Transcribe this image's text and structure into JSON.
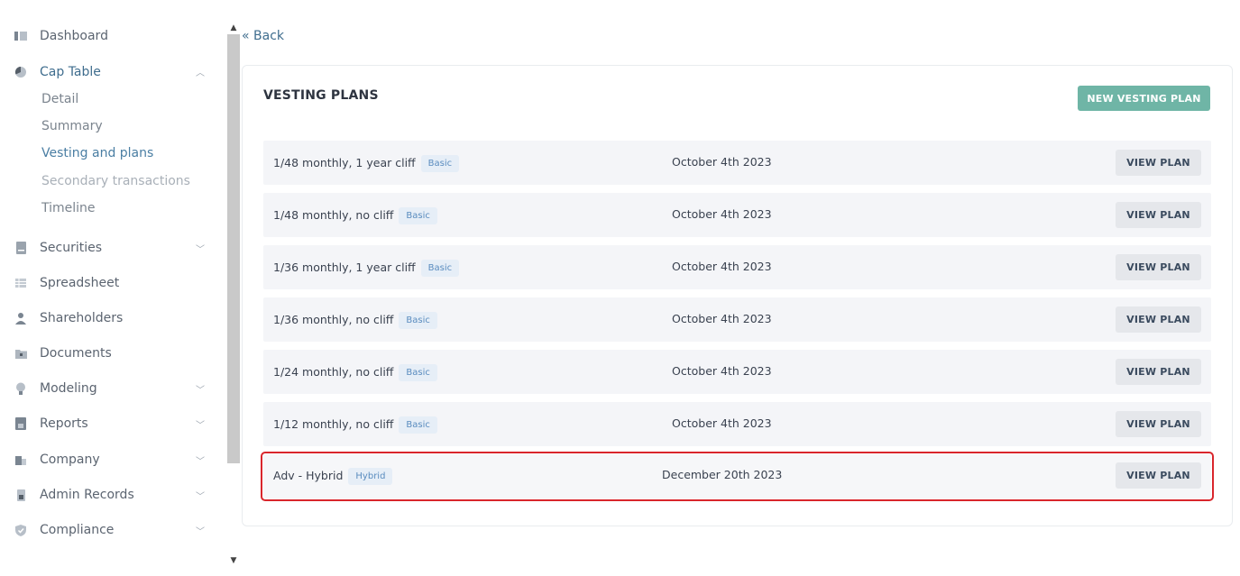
{
  "sidebar": {
    "items": [
      {
        "label": "Dashboard",
        "icon": "dashboard-icon"
      },
      {
        "label": "Cap Table",
        "icon": "pie-chart-icon"
      },
      {
        "label": "Securities",
        "icon": "certificate-icon"
      },
      {
        "label": "Spreadsheet",
        "icon": "table-icon"
      },
      {
        "label": "Shareholders",
        "icon": "person-icon"
      },
      {
        "label": "Documents",
        "icon": "folder-icon"
      },
      {
        "label": "Modeling",
        "icon": "lightbulb-icon"
      },
      {
        "label": "Reports",
        "icon": "report-icon"
      },
      {
        "label": "Company",
        "icon": "building-icon"
      },
      {
        "label": "Admin Records",
        "icon": "lock-icon"
      },
      {
        "label": "Compliance",
        "icon": "shield-icon"
      }
    ],
    "cap_table_sub": [
      "Detail",
      "Summary",
      "Vesting and plans",
      "Secondary transactions",
      "Timeline"
    ]
  },
  "back": {
    "label": "« Back"
  },
  "card": {
    "title": "VESTING PLANS",
    "new_button": "NEW VESTING PLAN",
    "view_label": "VIEW PLAN",
    "rows": [
      {
        "name": "1/48 monthly, 1 year cliff",
        "badge": "Basic",
        "date": "October 4th 2023"
      },
      {
        "name": "1/48 monthly, no cliff",
        "badge": "Basic",
        "date": "October 4th 2023"
      },
      {
        "name": "1/36 monthly, 1 year cliff",
        "badge": "Basic",
        "date": "October 4th 2023"
      },
      {
        "name": "1/36 monthly, no cliff",
        "badge": "Basic",
        "date": "October 4th 2023"
      },
      {
        "name": "1/24 monthly, no cliff",
        "badge": "Basic",
        "date": "October 4th 2023"
      },
      {
        "name": "1/12 monthly, no cliff",
        "badge": "Basic",
        "date": "October 4th 2023"
      },
      {
        "name": "Adv - Hybrid",
        "badge": "Hybrid",
        "date": "December 20th 2023"
      }
    ]
  },
  "colors": {
    "accent": "#6fb5a6",
    "link": "#3f6d8e",
    "highlight": "#d9262c",
    "badge_bg": "#e6eef7",
    "badge_text": "#5a8cbf"
  }
}
